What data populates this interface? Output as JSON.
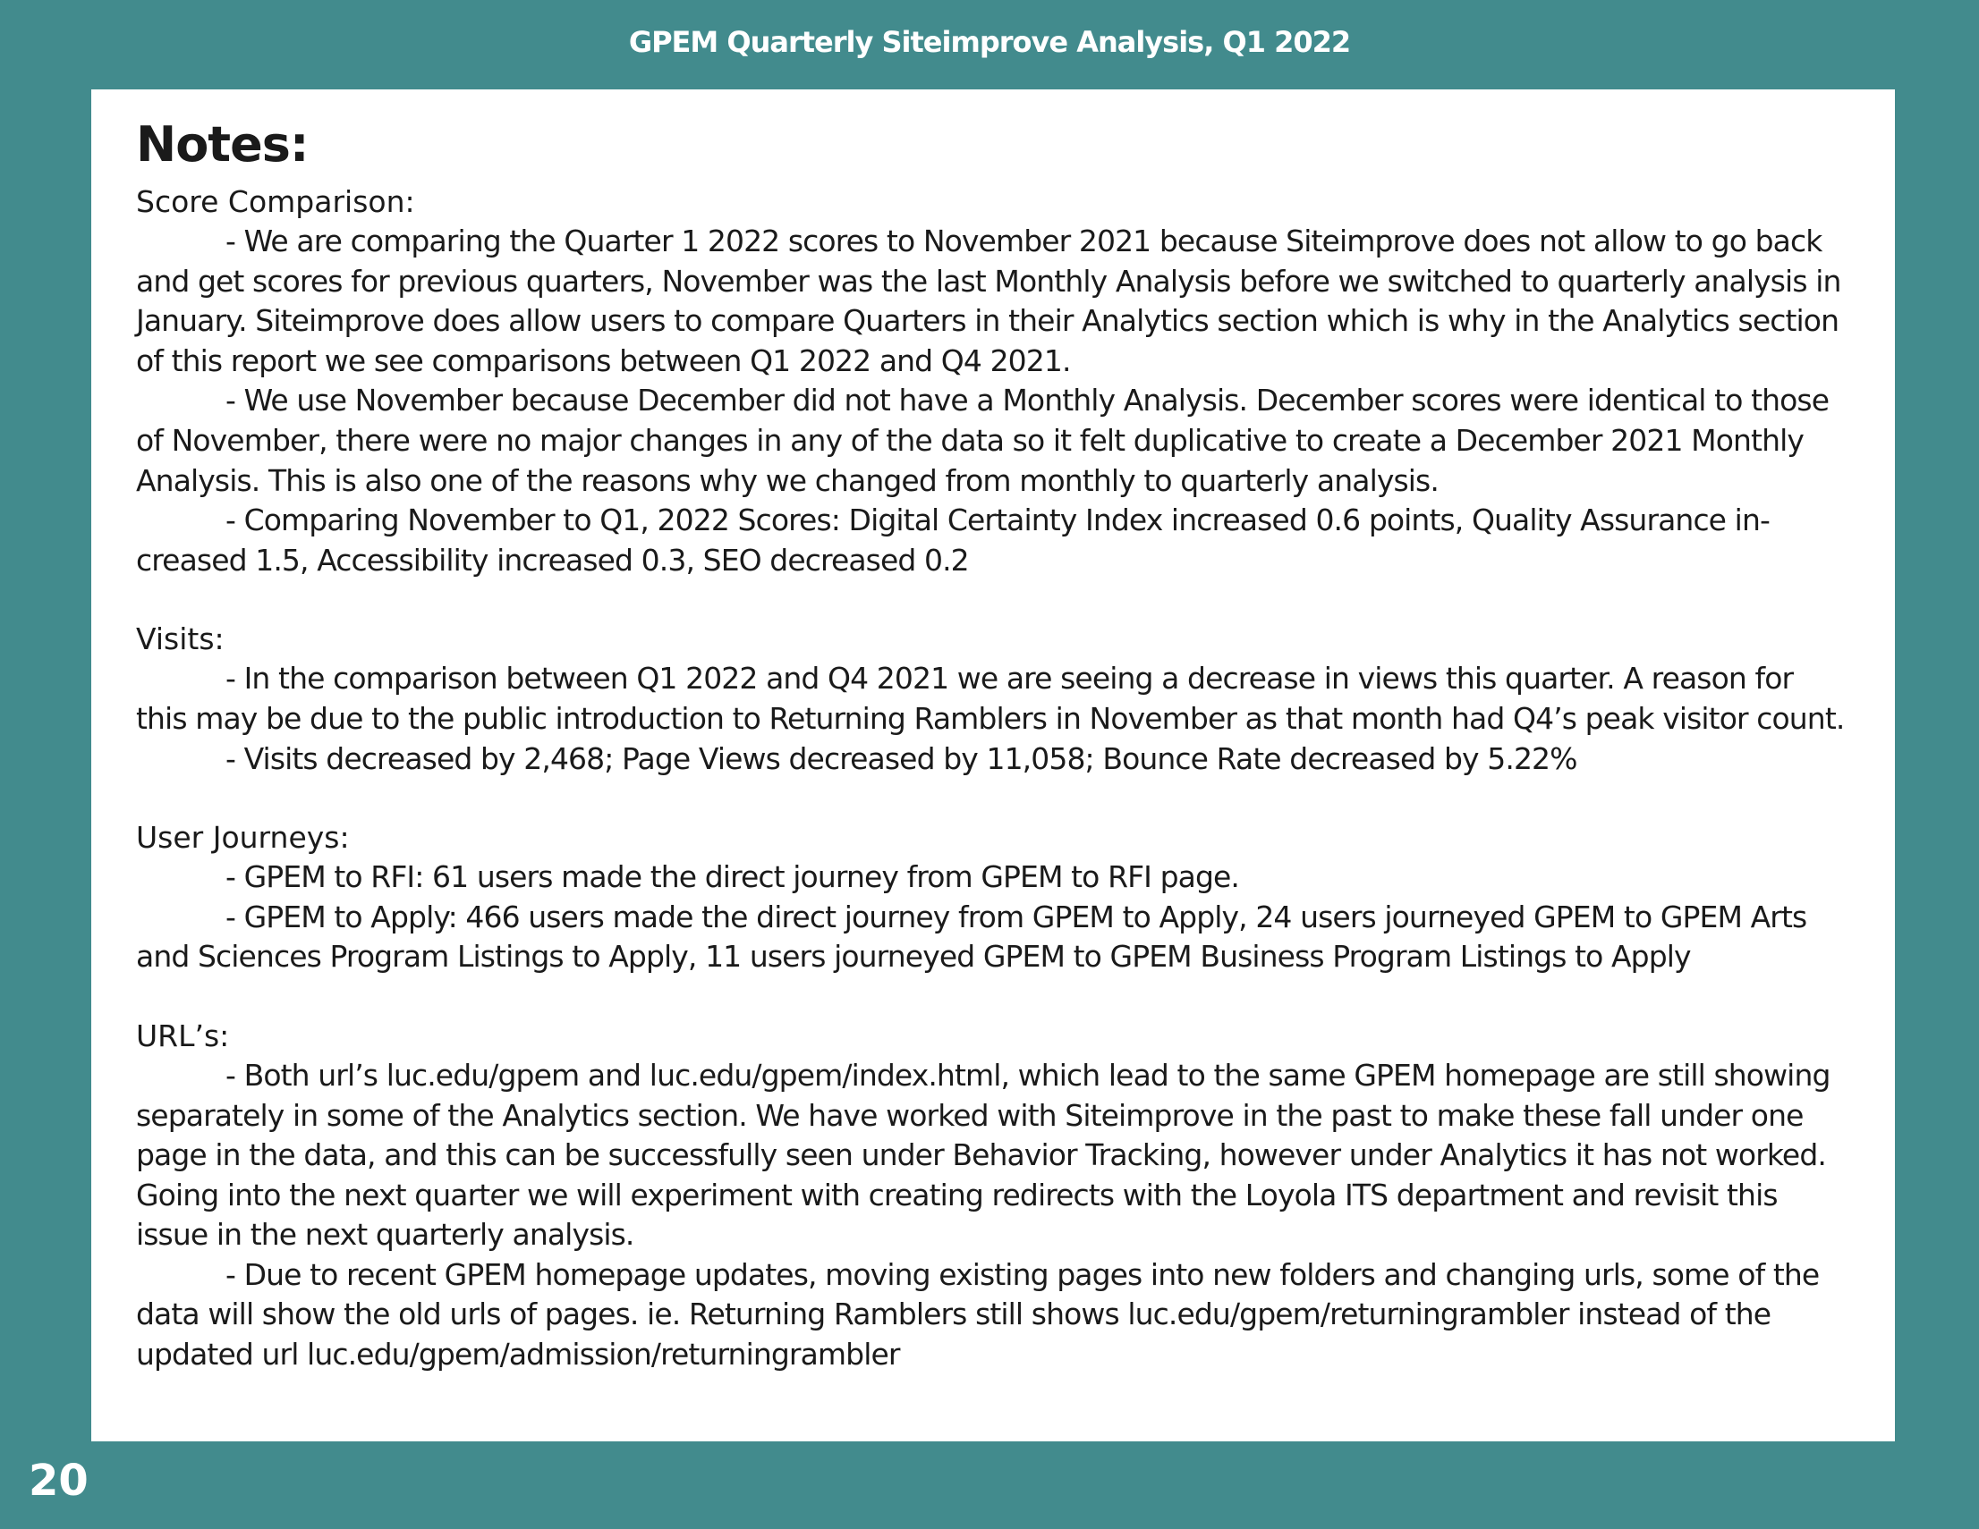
{
  "header": {
    "title": "GPEM Quarterly Siteimprove Analysis, Q1 2022"
  },
  "notes": {
    "title": "Notes:",
    "sections": [
      {
        "heading": "Score Comparison:",
        "items": [
          "- We are comparing the Quarter 1 2022 scores to November 2021 because Siteimprove does not allow to go back and get scores for previous quarters, November was the last Monthly Analysis before we switched to quarterly analysis in January. Siteimprove does allow users to compare Quarters in their Analytics section which is why in the Analytics section of this report we see comparisons between Q1 2022 and Q4 2021.",
          "- We use November because December did not have a Monthly Analysis. December scores were identical to those of November, there were no major changes in any of the data so it felt duplicative to create a December 2021 Monthly Analysis. This is also one of the reasons why we changed from monthly to quarterly analysis.",
          "- Comparing November to Q1, 2022 Scores: Digital Certainty Index increased 0.6 points, Quality Assurance in-creased 1.5, Accessibility increased 0.3, SEO decreased 0.2"
        ]
      },
      {
        "heading": "Visits:",
        "items": [
          "- In the comparison between Q1 2022 and Q4 2021 we are seeing a decrease in views this quarter. A reason for this may be due to the public introduction to Returning Ramblers in November as that month had Q4’s peak visitor count.",
          "- Visits decreased by 2,468; Page Views decreased by 11,058; Bounce Rate decreased by 5.22%"
        ]
      },
      {
        "heading": "User Journeys:",
        "items": [
          "- GPEM to RFI: 61 users made the direct journey from GPEM to RFI page.",
          "- GPEM to Apply: 466 users made the direct journey from GPEM to Apply, 24 users journeyed GPEM to GPEM Arts and Sciences Program Listings to Apply, 11 users journeyed GPEM to GPEM Business Program Listings to Apply"
        ]
      },
      {
        "heading": "URL’s:",
        "items": [
          "- Both url’s luc.edu/gpem and luc.edu/gpem/index.html, which lead to the same GPEM homepage are still showing separately in some of the Analytics section. We have worked with Siteimprove in the past to make these fall under one page in the data, and this can be successfully seen under Behavior Tracking, however under Analytics it has not worked. Going into the next quarter we will experiment with creating redirects with the Loyola ITS department and revisit this issue in the next quarterly analysis.",
          "- Due to recent GPEM homepage updates, moving existing pages into new folders and changing urls, some of the data will show the old urls of pages. ie. Returning Ramblers still shows luc.edu/gpem/returningrambler instead of the updated url luc.edu/gpem/admission/returningrambler"
        ]
      }
    ]
  },
  "footer": {
    "page_number": "20"
  },
  "colors": {
    "background": "#428b8d",
    "panel": "#ffffff",
    "text": "#1a1a1a"
  }
}
